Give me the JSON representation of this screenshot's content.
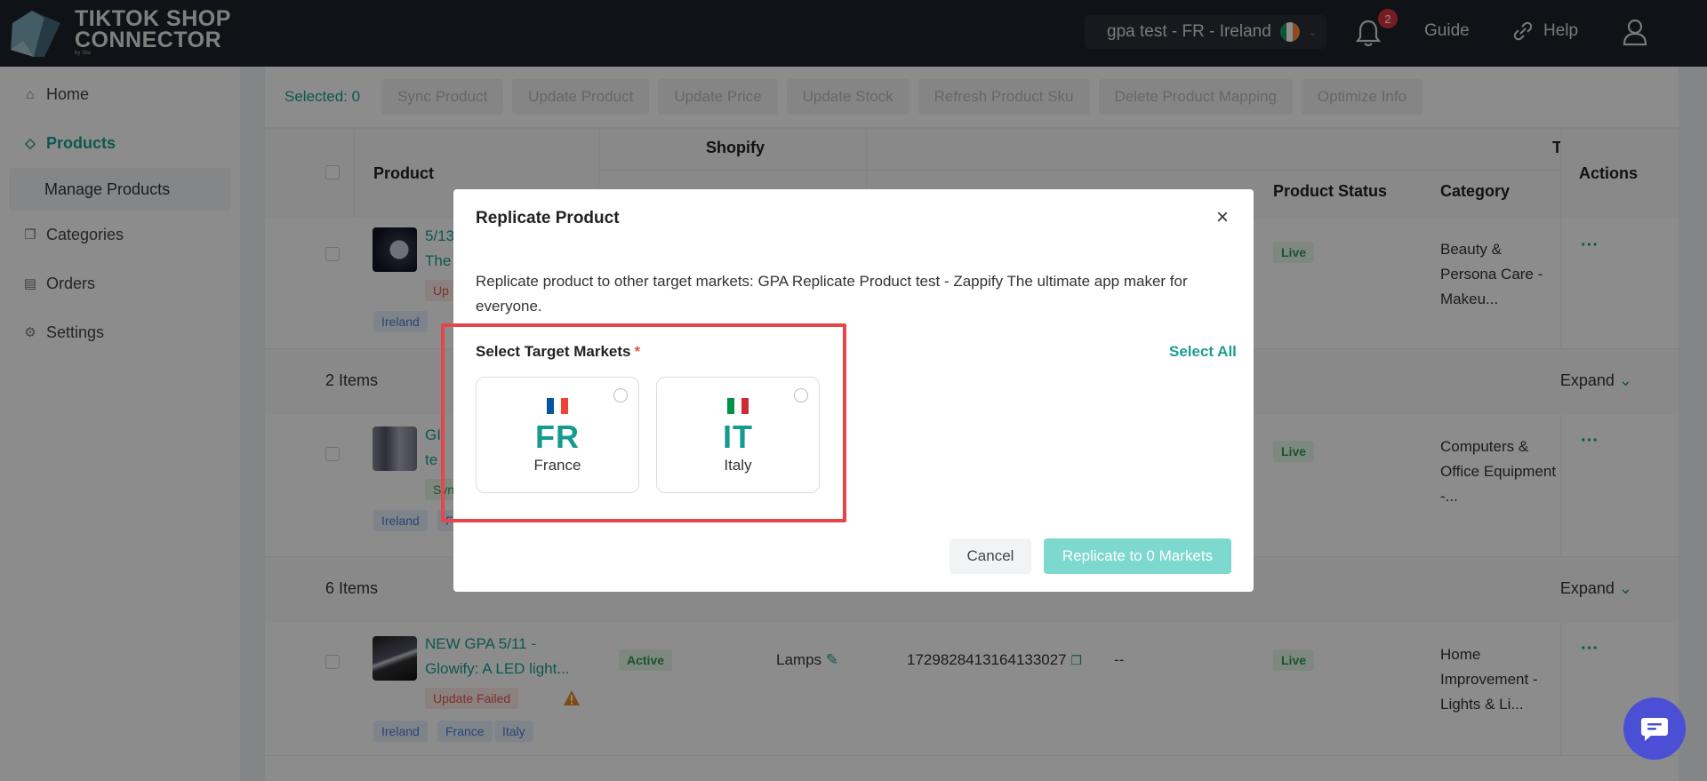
{
  "header": {
    "logo_line1": "TIKTOK SHOP",
    "logo_line2": "CONNECTOR",
    "logo_by": "by Sila",
    "store": "gpa test - FR  -  Ireland",
    "notification_count": "2",
    "guide": "Guide",
    "help": "Help"
  },
  "sidebar": {
    "items": [
      {
        "label": "Home",
        "icon": "home-icon"
      },
      {
        "label": "Products",
        "icon": "tag-icon"
      },
      {
        "label": "Manage Products"
      },
      {
        "label": "Categories",
        "icon": "copy-icon"
      },
      {
        "label": "Orders",
        "icon": "box-icon"
      },
      {
        "label": "Settings",
        "icon": "gear-icon"
      }
    ]
  },
  "toolbar": {
    "selected": "Selected: 0",
    "buttons": [
      "Sync Product",
      "Update Product",
      "Update Price",
      "Update Stock",
      "Refresh Product Sku",
      "Delete Product Mapping",
      "Optimize Info"
    ]
  },
  "table": {
    "headers": {
      "product": "Product",
      "shopify": "Shopify",
      "tiktok": "TikTo",
      "product_status": "Product Status",
      "category": "Category",
      "actions": "Actions"
    },
    "row1": {
      "title_a": "5/13",
      "title_b": "The",
      "badge": "Up",
      "tag": "Ireland",
      "status": "Live",
      "category": "Beauty & Persona Care - Makeu..."
    },
    "group1": {
      "count": "2 Items",
      "expand": "Expand"
    },
    "row2": {
      "title_a": "GI",
      "title_b": "te",
      "badge": "Syn",
      "tags": [
        "Ireland",
        "Fr"
      ],
      "status": "Live",
      "category": "Computers & Office Equipment -..."
    },
    "group2": {
      "count": "6 Items",
      "expand": "Expand"
    },
    "row3": {
      "title": "NEW GPA 5/11 - Glowify: A LED light...",
      "badge": "Update Failed",
      "tags": [
        "Ireland",
        "France",
        "Italy"
      ],
      "shopify_status": "Active",
      "type": "Lamps",
      "tiktok_id": "1729828413164133027",
      "dash": "--",
      "status": "Live",
      "category": "Home Improvement - Lights & Li..."
    }
  },
  "modal": {
    "title": "Replicate Product",
    "description": "Replicate product to other target markets: GPA Replicate Product test - Zappify The ultimate app maker for everyone.",
    "label": "Select Target Markets",
    "required_mark": "*",
    "select_all": "Select All",
    "markets": [
      {
        "code": "FR",
        "name": "France",
        "flag_colors": [
          "#0055a4",
          "#ffffff",
          "#ef4135"
        ]
      },
      {
        "code": "IT",
        "name": "Italy",
        "flag_colors": [
          "#009246",
          "#ffffff",
          "#ce2b37"
        ]
      }
    ],
    "cancel": "Cancel",
    "replicate": "Replicate to 0 Markets"
  },
  "colors": {
    "accent": "#1a9e92",
    "highlight": "#e8444a",
    "chat": "#4a4fd6"
  }
}
